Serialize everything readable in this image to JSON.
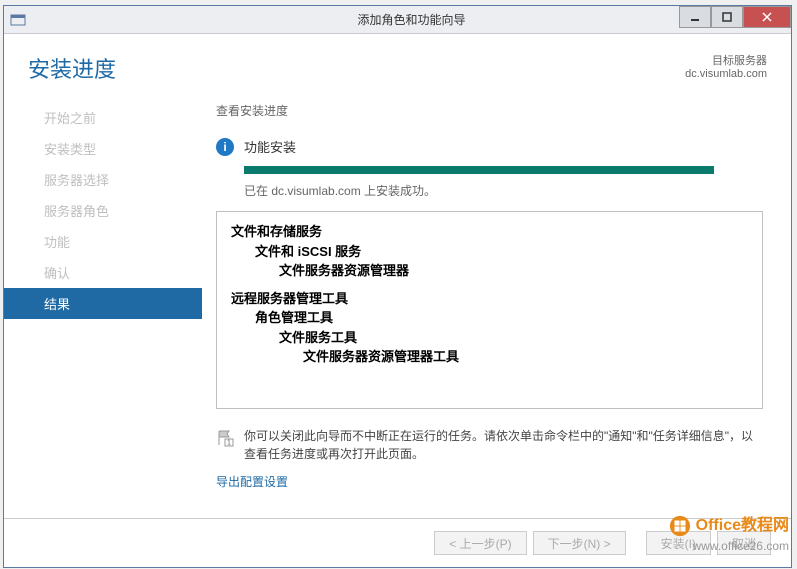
{
  "window": {
    "title": "添加角色和功能向导"
  },
  "header": {
    "heading": "安装进度",
    "target_label": "目标服务器",
    "target_value": "dc.visumlab.com"
  },
  "sidebar": {
    "items": [
      {
        "label": "开始之前"
      },
      {
        "label": "安装类型"
      },
      {
        "label": "服务器选择"
      },
      {
        "label": "服务器角色"
      },
      {
        "label": "功能"
      },
      {
        "label": "确认"
      },
      {
        "label": "结果"
      }
    ]
  },
  "main": {
    "section_label": "查看安装进度",
    "status_text": "功能安装",
    "success_msg": "已在 dc.visumlab.com 上安装成功。",
    "features": {
      "group1": {
        "l1": "文件和存储服务",
        "l2": "文件和 iSCSI 服务",
        "l3": "文件服务器资源管理器"
      },
      "group2": {
        "l1": "远程服务器管理工具",
        "l2": "角色管理工具",
        "l3": "文件服务工具",
        "l4": "文件服务器资源管理器工具"
      }
    },
    "note": "你可以关闭此向导而不中断正在运行的任务。请依次单击命令栏中的\"通知\"和\"任务详细信息\"，以查看任务进度或再次打开此页面。",
    "export_link": "导出配置设置"
  },
  "footer": {
    "prev": "< 上一步(P)",
    "next": "下一步(N) >",
    "install": "安装(I)",
    "cancel": "取消"
  },
  "watermark": {
    "line1": "Office教程网",
    "line2": "www.office26.com"
  }
}
